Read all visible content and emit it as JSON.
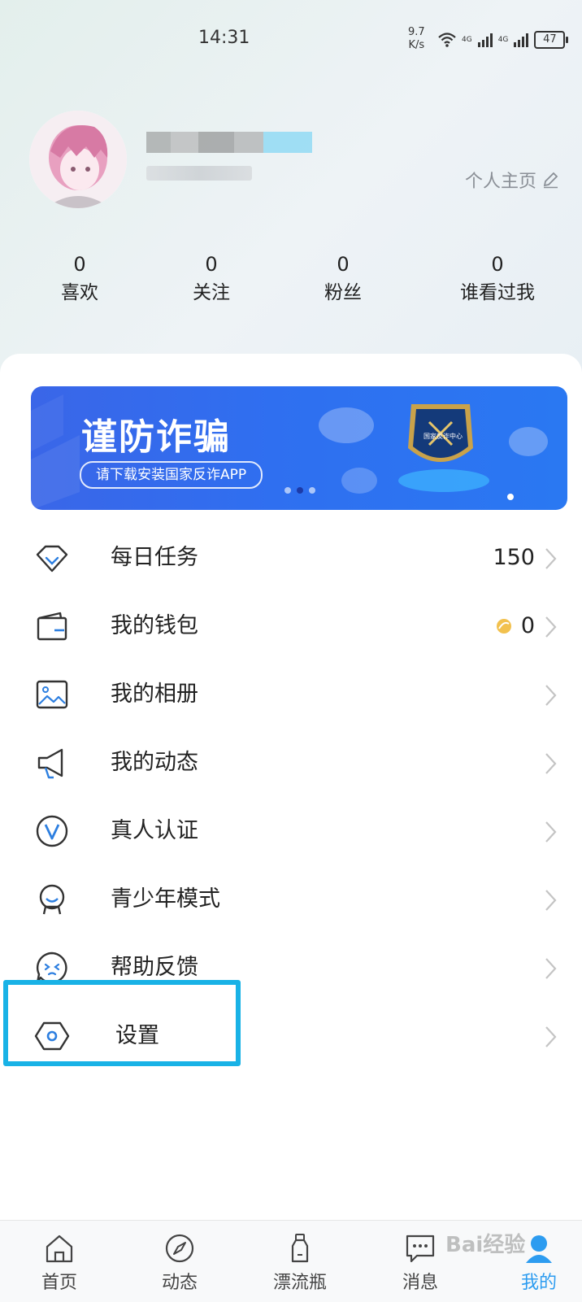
{
  "status_bar": {
    "time": "14:31",
    "speed_value": "9.7",
    "speed_unit": "K/s",
    "network_1": "4G",
    "network_2": "4G",
    "battery": "47"
  },
  "profile": {
    "homepage_label": "个人主页",
    "stats": [
      {
        "value": "0",
        "label": "喜欢"
      },
      {
        "value": "0",
        "label": "关注"
      },
      {
        "value": "0",
        "label": "粉丝"
      },
      {
        "value": "0",
        "label": "谁看过我"
      }
    ]
  },
  "banner": {
    "title": "谨防诈骗",
    "subtitle": "请下载安装国家反诈APP",
    "badge_text": "国家反诈中心",
    "colors": {
      "start": "#3a66e8",
      "end": "#2a78f2"
    }
  },
  "menu": {
    "items": [
      {
        "label": "每日任务",
        "value": "150",
        "icon": "diamond-icon"
      },
      {
        "label": "我的钱包",
        "value": "0",
        "icon": "wallet-icon"
      },
      {
        "label": "我的相册",
        "value": "",
        "icon": "photo-icon"
      },
      {
        "label": "我的动态",
        "value": "",
        "icon": "megaphone-icon"
      },
      {
        "label": "真人认证",
        "value": "",
        "icon": "verified-v-icon"
      },
      {
        "label": "青少年模式",
        "value": "",
        "icon": "child-face-icon"
      },
      {
        "label": "帮助反馈",
        "value": "",
        "icon": "help-chat-icon"
      },
      {
        "label": "设置",
        "value": "",
        "icon": "settings-hexagon-icon"
      }
    ],
    "highlight_color": "#19b2e6"
  },
  "tabbar": {
    "tabs": [
      {
        "label": "首页",
        "icon": "home-icon"
      },
      {
        "label": "动态",
        "icon": "compass-icon"
      },
      {
        "label": "漂流瓶",
        "icon": "bottle-icon"
      },
      {
        "label": "消息",
        "icon": "chat-icon"
      },
      {
        "label": "我的",
        "icon": "profile-icon",
        "active": true
      }
    ],
    "active_color": "#2d9cf0"
  },
  "watermark": "Bai经验"
}
